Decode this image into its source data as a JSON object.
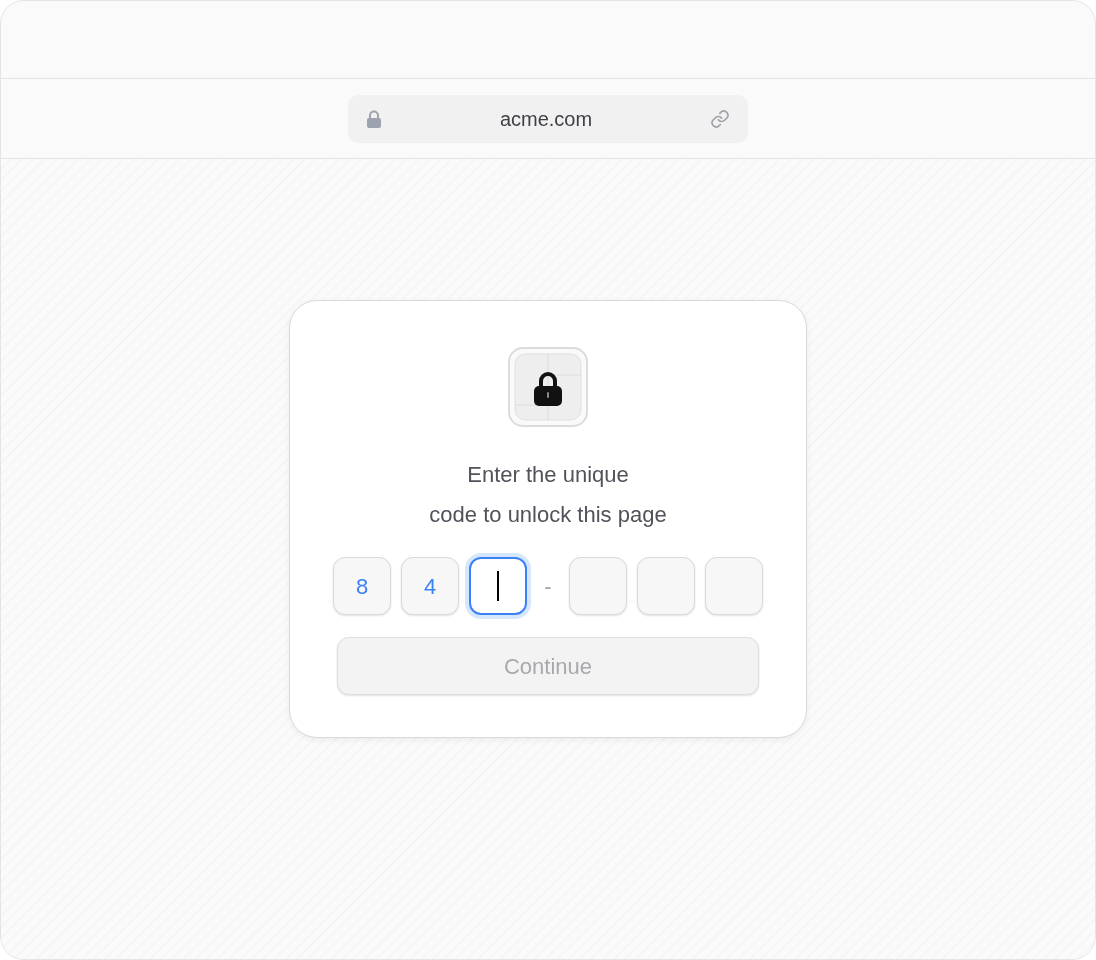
{
  "address_bar": {
    "url": "acme.com"
  },
  "unlock_card": {
    "prompt_lines": [
      "Enter the unique",
      "code to unlock this page"
    ],
    "code_slots": [
      {
        "kind": "digit",
        "value": "8",
        "selected": false
      },
      {
        "kind": "digit",
        "value": "4",
        "selected": false
      },
      {
        "kind": "digit",
        "selected": true
      },
      {
        "kind": "separator",
        "text": "-"
      },
      {
        "kind": "digit",
        "selected": false
      },
      {
        "kind": "digit",
        "selected": false
      },
      {
        "kind": "digit",
        "selected": false
      }
    ],
    "button": {
      "label": "Continue",
      "disabled": true
    }
  }
}
